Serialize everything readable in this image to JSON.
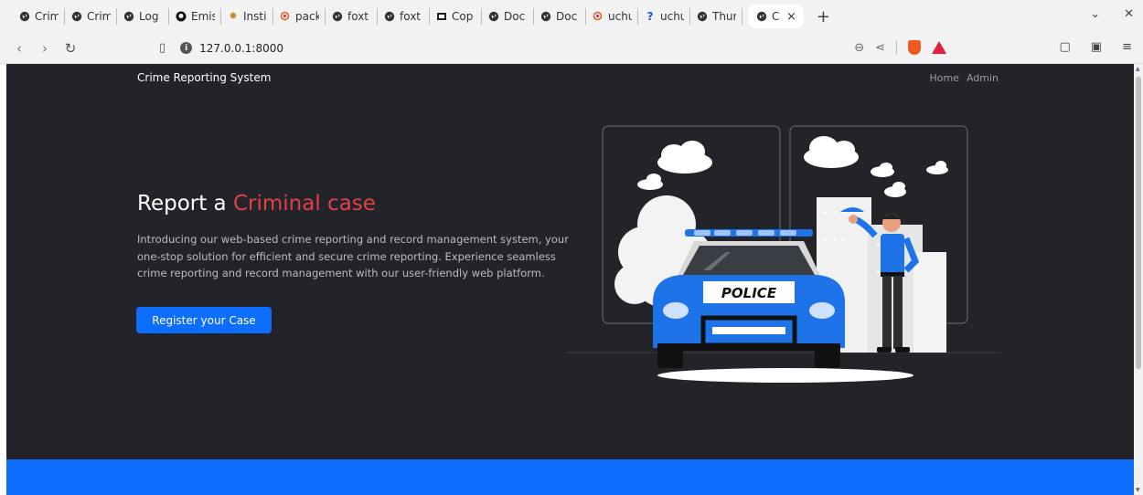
{
  "browser": {
    "tabs": [
      {
        "icon": "globe-icon",
        "label": "Crim"
      },
      {
        "icon": "globe-icon",
        "label": "Crim"
      },
      {
        "icon": "globe-icon",
        "label": "Log"
      },
      {
        "icon": "github-icon",
        "label": "Emis"
      },
      {
        "icon": "crest-icon",
        "label": "Insti"
      },
      {
        "icon": "search-shield-icon",
        "label": "pack"
      },
      {
        "icon": "globe-icon",
        "label": "foxt"
      },
      {
        "icon": "globe-icon",
        "label": "foxt"
      },
      {
        "icon": "copy-icon",
        "label": "Cop"
      },
      {
        "icon": "globe-icon",
        "label": "Doc"
      },
      {
        "icon": "globe-icon",
        "label": "Doc"
      },
      {
        "icon": "search-shield-icon",
        "label": "uchu"
      },
      {
        "icon": "question-icon",
        "label": "uchu"
      },
      {
        "icon": "globe-icon",
        "label": "Thur"
      }
    ],
    "active_tab": {
      "icon": "globe-icon",
      "label": "C"
    },
    "url": "127.0.0.1:8000"
  },
  "site": {
    "brand": "Crime Reporting System",
    "nav": {
      "home": "Home",
      "admin": "Admin"
    },
    "hero": {
      "title_prefix": "Report a ",
      "title_accent": "Criminal case",
      "description": "Introducing our web-based crime reporting and record management system, your one-stop solution for efficient and secure crime reporting. Experience seamless crime reporting and record management with our user-friendly web platform.",
      "cta": "Register your Case"
    },
    "illustration": {
      "car_label": "POLICE"
    }
  },
  "colors": {
    "page_bg": "#222429",
    "accent_red": "#e04047",
    "primary_blue": "#0d6efd",
    "police_blue": "#1f73e8"
  }
}
